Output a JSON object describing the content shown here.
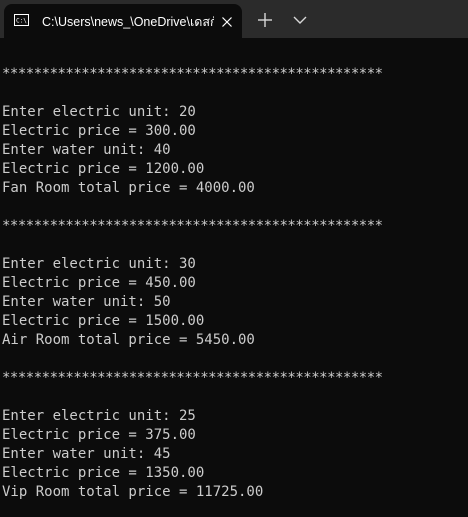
{
  "window": {
    "tab_title": "C:\\Users\\news_\\OneDrive\\เดสก์",
    "icon_names": {
      "tab": "console-icon",
      "close": "close-icon",
      "new_tab": "plus-icon",
      "dropdown": "chevron-down-icon"
    }
  },
  "terminal": {
    "colors": {
      "background": "#0c0c0c",
      "text": "#cccccc",
      "titlebar": "#2b2b2b"
    },
    "lines": [
      "************************************************",
      "",
      "Enter electric unit: 20",
      "Electric price = 300.00",
      "Enter water unit: 40",
      "Electric price = 1200.00",
      "Fan Room total price = 4000.00",
      "",
      "************************************************",
      "",
      "Enter electric unit: 30",
      "Electric price = 450.00",
      "Enter water unit: 50",
      "Electric price = 1500.00",
      "Air Room total price = 5450.00",
      "",
      "************************************************",
      "",
      "Enter electric unit: 25",
      "Electric price = 375.00",
      "Enter water unit: 45",
      "Electric price = 1350.00",
      "Vip Room total price = 11725.00"
    ]
  }
}
